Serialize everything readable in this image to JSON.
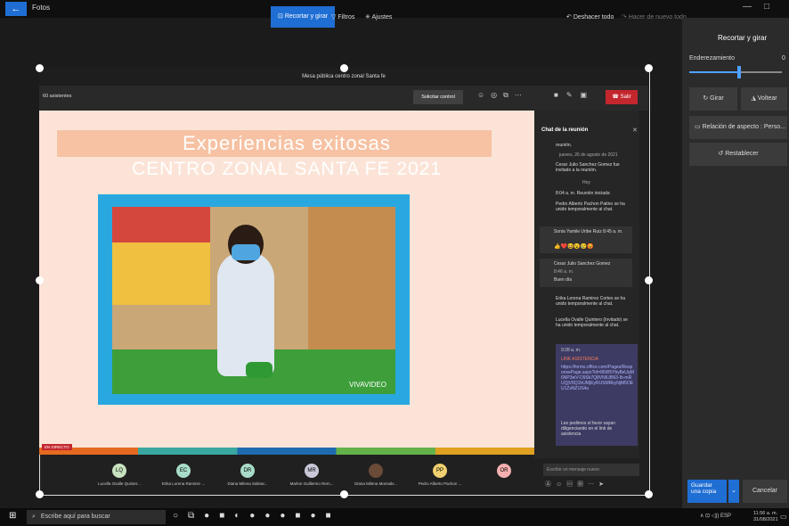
{
  "app": {
    "title": "Fotos",
    "back_icon": "←"
  },
  "window_controls": {
    "min": "—",
    "max": "□"
  },
  "toolbar": {
    "crop": "Recortar y girar",
    "filters": "Filtros",
    "adjust": "Ajustes",
    "undo_all": "Deshacer todo",
    "redo_all": "Hacer de nuevo todo"
  },
  "panel": {
    "title": "Recortar y girar",
    "straighten_label": "Enderezamiento",
    "straighten_value": "0",
    "rotate": "Girar",
    "flip": "Voltear",
    "aspect": "Relación de aspecto : Perso...",
    "reset": "Restablecer",
    "save_copy": "Guardar una copia",
    "cancel": "Cancelar"
  },
  "meeting": {
    "window_title": "Mesa pública centro zonal Santa fe",
    "attendees": "60 asistentes",
    "request_control": "Solicitar control",
    "leave": "Salir",
    "live_badge": "EN DIRECTO",
    "slide_title_1": "Experiencias exitosas",
    "slide_title_2": "CENTRO ZONAL  SANTA FE 2021",
    "watermark": "VIVAVIDEO"
  },
  "chat": {
    "title": "Chat de la reunión",
    "lines": [
      "reunión.",
      "jueves, 26 de agosto de 2021",
      "Cesar Julio Sanchez Gomez fue invitado a la reunión.",
      "Hoy",
      "8:04 a. m.  Reunión iniciada",
      "Pedro Alberto Pachon Patino se ha unido temporalmente al chat.",
      "Sonia Yamile Uribe Ruiz  8:45 a. m.",
      "Cesar Julio Sanchez Gomez",
      "8:46 a. m.",
      "Buen día",
      "Erika Lorena Ramirez Cortes se ha unido temporalmente al chat.",
      "Lucella Ovalle Quintero (Invitado) se ha unido temporalmente al chat.",
      "9:28 a. m.",
      "LINK ASISTENCIA",
      "https://forms.office.com/Pages/ResponsePage.aspx?id=86W5Yby8eUqM6NP3eiV-D9Sk7Q8VNIU8N3-Ib-mRUQjV8Q1hUMjEyRUSMRkyNjM5OEU1ZxNZUS4u",
      "Les pedimos el favor vayan diligenciando en el link de asistencia"
    ],
    "input_placeholder": "Escribir un mensaje nuevo"
  },
  "participants": [
    {
      "initials": "LQ",
      "name": "Lucella Ovalle Quinter...",
      "color": "#c8e2c0"
    },
    {
      "initials": "EC",
      "name": "Erika Lorena Ramirez ...",
      "color": "#a8dcc8"
    },
    {
      "initials": "DR",
      "name": "Diana Milena Salinar...",
      "color": "#a8dcc8"
    },
    {
      "initials": "MR",
      "name": "Marlon Guillermo Rem...",
      "color": "#c8c8d8"
    },
    {
      "initials": "",
      "name": "Diana Milena Monsalv...",
      "color": "#6a4b38"
    },
    {
      "initials": "PP",
      "name": "Pedro Alberto Pachon ...",
      "color": "#f0d070"
    },
    {
      "initials": "OR",
      "name": "",
      "color": "#f4b0b0"
    }
  ],
  "taskbar": {
    "search_placeholder": "Escribe aquí para buscar",
    "lang": "ESP",
    "time": "11:56 a. m.",
    "date": "31/08/2021"
  }
}
